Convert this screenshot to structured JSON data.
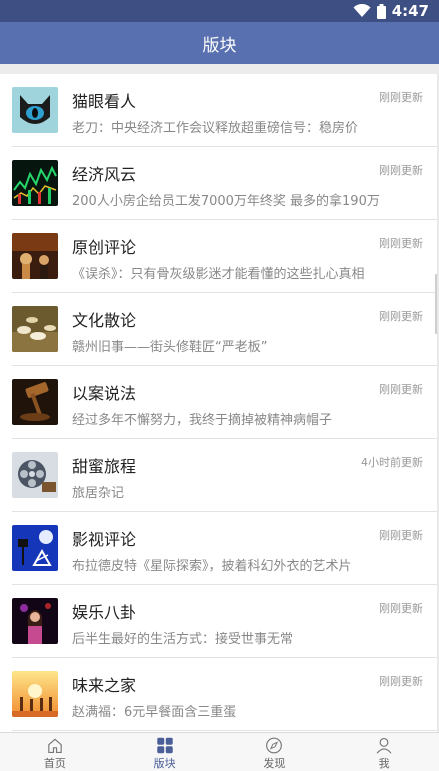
{
  "status": {
    "time": "4:47"
  },
  "header": {
    "title": "版块"
  },
  "boards": [
    {
      "title": "猫眼看人",
      "desc": "老刀：中央经济工作会议释放超重磅信号：稳房价",
      "time": "刚刚更新",
      "icon": "cat-eye-icon"
    },
    {
      "title": "经济风云",
      "desc": "200人小房企给员工发7000万年终奖 最多的拿190万",
      "time": "刚刚更新",
      "icon": "stock-chart-icon"
    },
    {
      "title": "原创评论",
      "desc": "《误杀》：只有骨灰级影迷才能看懂的这些扎心真相",
      "time": "刚刚更新",
      "icon": "stage-icon"
    },
    {
      "title": "文化散论",
      "desc": "赣州旧事——街头修鞋匠“严老板”",
      "time": "刚刚更新",
      "icon": "tea-icon"
    },
    {
      "title": "以案说法",
      "desc": "经过多年不懈努力，我终于摘掉被精神病帽子",
      "time": "刚刚更新",
      "icon": "gavel-icon"
    },
    {
      "title": "甜蜜旅程",
      "desc": "旅居杂记",
      "time": "4小时前更新",
      "icon": "film-reel-icon"
    },
    {
      "title": "影视评论",
      "desc": "布拉德皮特《星际探索》，披着科幻外衣的艺术片",
      "time": "刚刚更新",
      "icon": "film-set-icon"
    },
    {
      "title": "娱乐八卦",
      "desc": "后半生最好的生活方式：接受世事无常",
      "time": "刚刚更新",
      "icon": "singer-icon"
    },
    {
      "title": "味来之家",
      "desc": "赵满福：6元早餐面含三重蛋",
      "time": "刚刚更新",
      "icon": "sunset-icon"
    }
  ],
  "tabs": [
    {
      "label": "首页",
      "icon": "home-icon"
    },
    {
      "label": "版块",
      "icon": "grid-icon"
    },
    {
      "label": "发现",
      "icon": "compass-icon"
    },
    {
      "label": "我",
      "icon": "user-icon"
    }
  ],
  "colors": {
    "status_bar": "#3d4f83",
    "header": "#5870b0",
    "active_tab": "#4a5f98"
  }
}
